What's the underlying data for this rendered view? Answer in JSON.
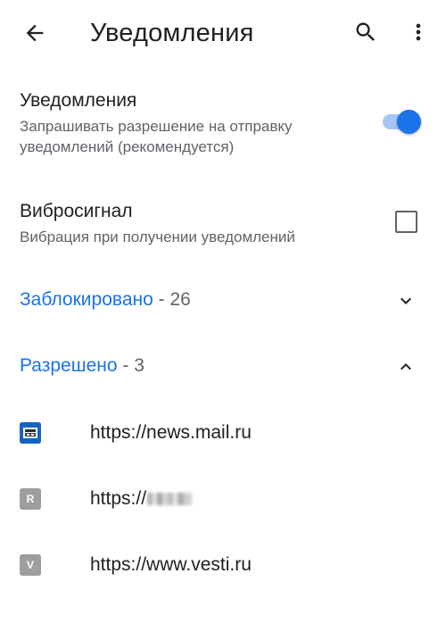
{
  "app_bar": {
    "title": "Уведомления",
    "back_icon": "arrow-back-icon",
    "search_icon": "search-icon",
    "more_icon": "more-vert-icon"
  },
  "notifications_pref": {
    "title": "Уведомления",
    "summary": "Запрашивать разрешение на отправку уведомлений (рекомендуется)",
    "enabled": true
  },
  "vibration_pref": {
    "title": "Вибросигнал",
    "summary": "Вибрация при получении уведомлений",
    "checked": false
  },
  "blocked_section": {
    "label": "Заблокировано",
    "count": " - 26",
    "expanded": false,
    "chevron_icon": "chevron-down-icon"
  },
  "allowed_section": {
    "label": "Разрешено",
    "count": " - 3",
    "expanded": true,
    "chevron_icon": "chevron-up-icon",
    "sites": [
      {
        "url": "https://news.mail.ru",
        "favicon": "news-mail-favicon",
        "favicon_letter": ""
      },
      {
        "url": "https://",
        "favicon": "letter-r-favicon",
        "favicon_letter": "R",
        "redacted": true
      },
      {
        "url": "https://www.vesti.ru",
        "favicon": "letter-v-favicon",
        "favicon_letter": "V"
      }
    ]
  },
  "colors": {
    "accent": "#1a73e8",
    "toggle_track": "#a6c6f6",
    "text_primary": "#202124",
    "text_secondary": "#5f6368",
    "favicon_gray": "#9e9e9e"
  }
}
